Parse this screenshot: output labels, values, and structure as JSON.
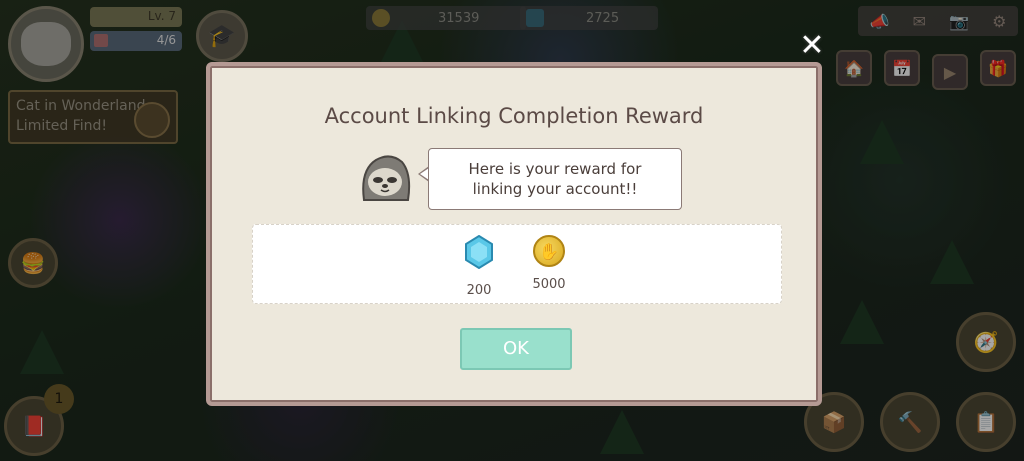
{
  "hud": {
    "level_label": "Lv. 7",
    "house_count": "4/6",
    "coins": "31539",
    "gems": "2725",
    "event_banner": "Cat in Wonderland Limited Find!",
    "bottom_badge": "1"
  },
  "modal": {
    "title": "Account Linking Completion Reward",
    "message_line1": "Here is your reward for",
    "message_line2": "linking your account!!",
    "rewards": [
      {
        "icon": "gem-icon",
        "amount": "200"
      },
      {
        "icon": "coin-icon",
        "amount": "5000"
      }
    ],
    "ok_label": "OK",
    "close_symbol": "✕"
  },
  "colors": {
    "modal_bg": "#ede8dc",
    "modal_border": "#b59a94",
    "ok_button": "#99e0cc",
    "title_text": "#5b4a46"
  }
}
